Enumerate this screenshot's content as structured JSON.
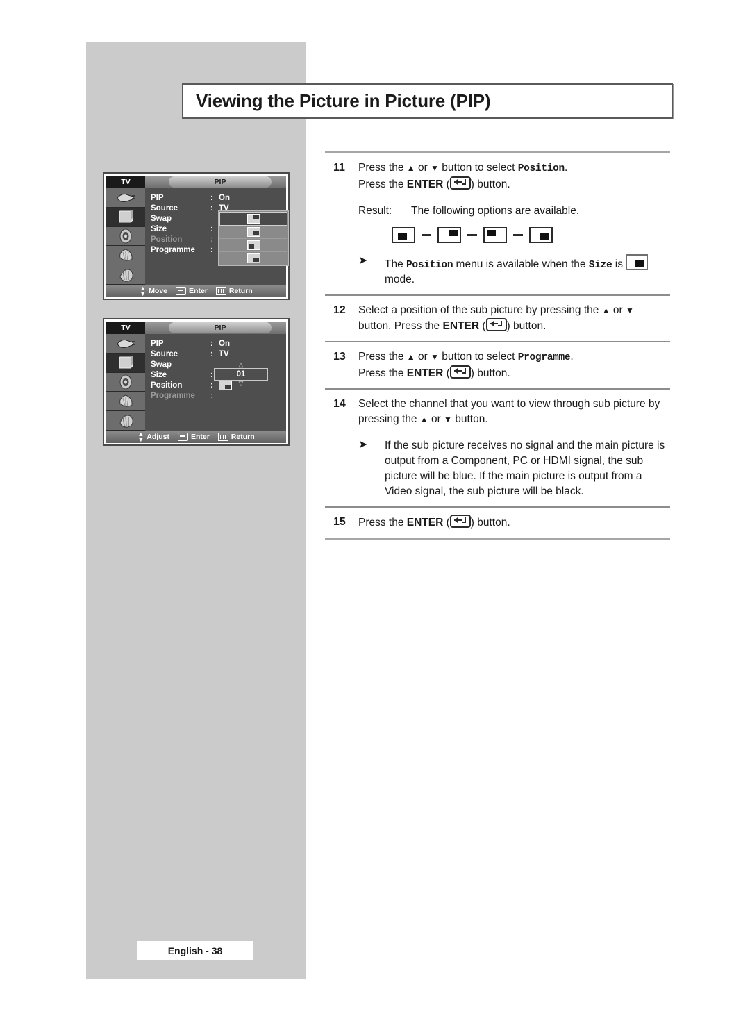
{
  "page": {
    "title": "Viewing the Picture in Picture (PIP)",
    "footer": "English - 38"
  },
  "osd_screens": [
    {
      "tv_label": "TV",
      "tab_label": "PIP",
      "icons": [
        "input-plug-icon",
        "tv-picture-icon",
        "speaker-sound-icon",
        "fan-setup-icon",
        "hand-setup-icon"
      ],
      "selected_icon_index": 1,
      "rows": [
        {
          "label": "PIP",
          "colon": ":",
          "value": "On",
          "dim": false
        },
        {
          "label": "Source",
          "colon": ":",
          "value": "TV",
          "dim": false
        },
        {
          "label": "Swap",
          "colon": "",
          "value": "",
          "dim": false
        },
        {
          "label": "Size",
          "colon": ":",
          "value": "pip-br",
          "dim": false
        },
        {
          "label": "Position",
          "colon": ":",
          "value": "",
          "dim": true
        },
        {
          "label": "Programme",
          "colon": ":",
          "value": "",
          "dim": false
        }
      ],
      "position_options": [
        "pip-tr",
        "pip-br",
        "pip-bl",
        "pip-br"
      ],
      "position_selected_index": 0,
      "hints": [
        {
          "icon": "up-down-arrows-icon",
          "label": "Move"
        },
        {
          "icon": "enter-key-icon",
          "label": "Enter"
        },
        {
          "icon": "menu-key-icon",
          "label": "Return"
        }
      ]
    },
    {
      "tv_label": "TV",
      "tab_label": "PIP",
      "icons": [
        "input-plug-icon",
        "tv-picture-icon",
        "speaker-sound-icon",
        "fan-setup-icon",
        "hand-setup-icon"
      ],
      "selected_icon_index": 1,
      "rows": [
        {
          "label": "PIP",
          "colon": ":",
          "value": "On",
          "dim": false
        },
        {
          "label": "Source",
          "colon": ":",
          "value": "TV",
          "dim": false
        },
        {
          "label": "Swap",
          "colon": "",
          "value": "",
          "dim": false
        },
        {
          "label": "Size",
          "colon": ":",
          "value": "pip-br",
          "dim": false
        },
        {
          "label": "Position",
          "colon": ":",
          "value": "pip-br",
          "dim": false
        },
        {
          "label": "Programme",
          "colon": ":",
          "value": "",
          "dim": true
        }
      ],
      "programme_value": "01",
      "hints": [
        {
          "icon": "up-down-arrows-icon",
          "label": "Adjust"
        },
        {
          "icon": "enter-key-icon",
          "label": "Enter"
        },
        {
          "icon": "menu-key-icon",
          "label": "Return"
        }
      ]
    }
  ],
  "steps": {
    "s11": {
      "num": "11",
      "line1_a": "Press the ",
      "line1_b": " or ",
      "line1_c": " button to select ",
      "line1_mono": "Position",
      "line1_d": ".",
      "line2_a": "Press the ",
      "line2_bold": "ENTER",
      "line2_b": " (",
      "line2_c": ") button.",
      "result_label": "Result:",
      "result_text": "The following options are available.",
      "note_a": "The ",
      "note_mono1": "Position",
      "note_b": " menu is available when the ",
      "note_mono2": "Size",
      "note_c": " is ",
      "note_d": "mode."
    },
    "s12": {
      "num": "12",
      "line1_a": "Select a position of the sub picture by pressing the ",
      "line1_b": " or ",
      "line2_a": "button. Press the ",
      "line2_bold": "ENTER",
      "line2_b": " (",
      "line2_c": ") button."
    },
    "s13": {
      "num": "13",
      "line1_a": "Press the ",
      "line1_b": " or ",
      "line1_c": " button to select ",
      "line1_mono": "Programme",
      "line1_d": ".",
      "line2_a": "Press the ",
      "line2_bold": "ENTER",
      "line2_b": " (",
      "line2_c": ") button."
    },
    "s14": {
      "num": "14",
      "line1_a": "Select the channel that you want to view through sub picture by",
      "line2_a": "pressing the ",
      "line2_b": " or ",
      "line2_c": " button.",
      "note_text": "If the sub picture receives no signal and the main picture is output from a Component, PC or HDMI signal, the sub picture will be blue. If the main picture is output from a Video signal, the sub picture will be black."
    },
    "s15": {
      "num": "15",
      "line1_a": "Press the ",
      "line1_bold": "ENTER",
      "line1_b": " (",
      "line1_c": ") button."
    }
  }
}
